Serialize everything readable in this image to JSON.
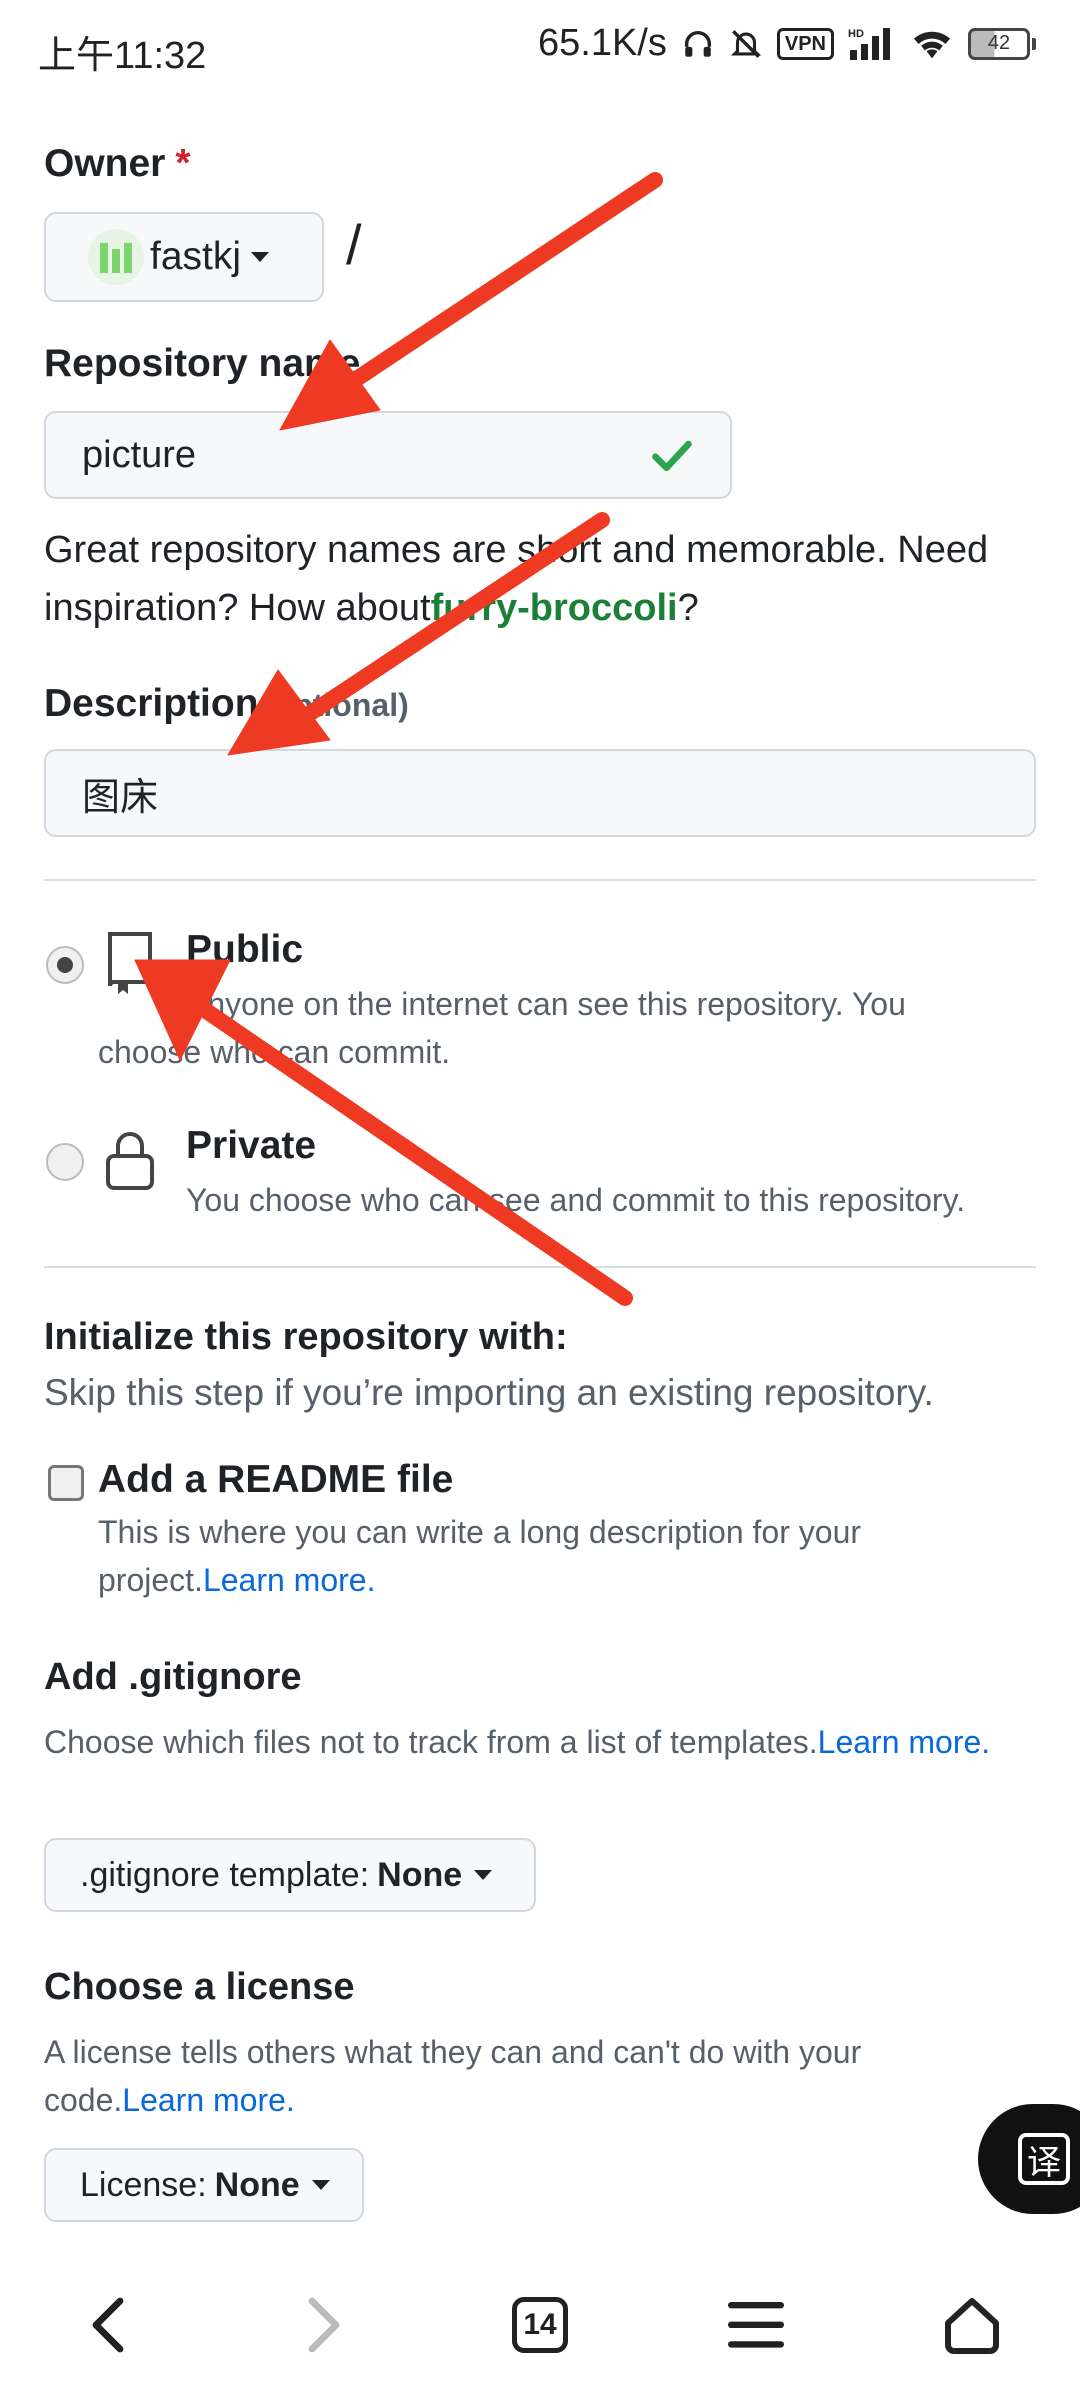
{
  "status_bar": {
    "time": "上午11:32",
    "net_speed": "65.1K/s",
    "vpn": "VPN",
    "hd": "HD",
    "battery": "42"
  },
  "form": {
    "owner": {
      "label": "Owner",
      "required_mark": "*",
      "value": "fastkj",
      "slash": "/"
    },
    "repo_name": {
      "label": "Repository name",
      "value": "picture"
    },
    "hint": {
      "text1": "Great repository names are short and memorable. Need inspiration? How about",
      "suggestion": "furry-broccoli",
      "text2": "?"
    },
    "description": {
      "label": "Description",
      "optional": "(optional)",
      "value": "图床"
    },
    "visibility": {
      "public": {
        "title": "Public",
        "desc": "Anyone on the internet can see this repository. You choose who can commit."
      },
      "private": {
        "title": "Private",
        "desc": "You choose who can see and commit to this repository."
      }
    },
    "init": {
      "title": "Initialize this repository with:",
      "desc": "Skip this step if you’re importing an existing repository.",
      "readme": {
        "title": "Add a README file",
        "desc": "This is where you can write a long description for your project.",
        "link": "Learn more."
      }
    },
    "gitignore": {
      "title": "Add .gitignore",
      "desc": "Choose which files not to track from a list of templates.",
      "link": "Learn more.",
      "button_label": ".gitignore template:",
      "button_value": "None"
    },
    "license": {
      "title": "Choose a license",
      "desc": "A license tells others what they can and can't do with your code.",
      "link": "Learn more.",
      "button_label": "License:",
      "button_value": "None"
    }
  },
  "fab": {
    "translate_glyph": "译"
  },
  "navbar": {
    "tab_count": "14"
  },
  "colors": {
    "arrow": "#ee3a22",
    "link_green": "#1a7f37",
    "link_blue": "#0969da"
  }
}
